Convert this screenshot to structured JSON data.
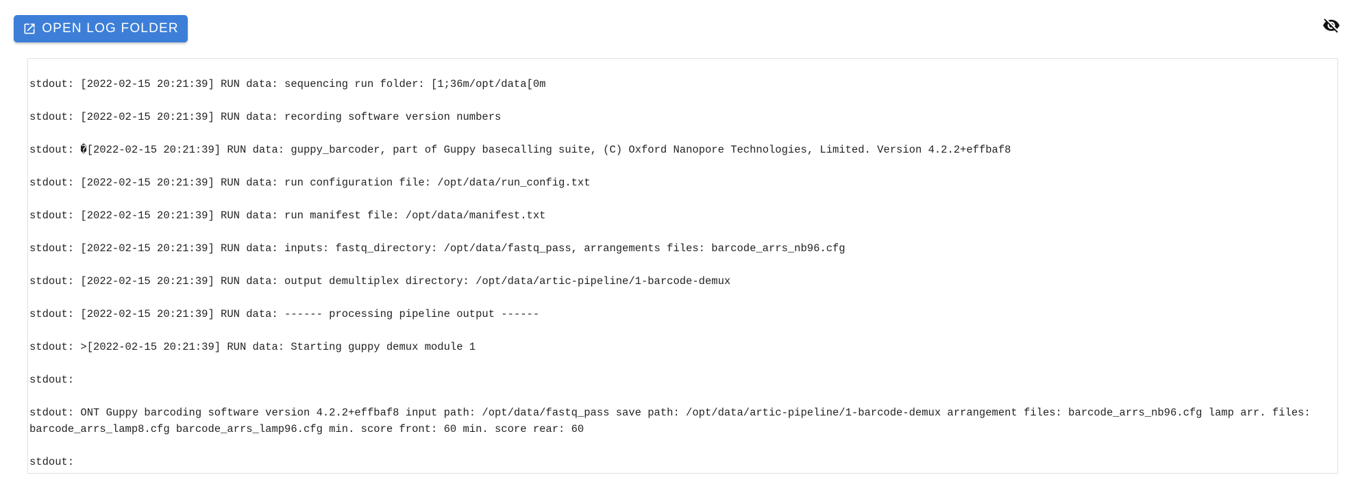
{
  "toolbar": {
    "open_log_folder_label": "OPEN LOG FOLDER",
    "open_log_folder_icon": "open-in-new-icon",
    "hide_toggle_icon": "eye-off-icon"
  },
  "colors": {
    "button_bg": "#3d7fd8",
    "button_text": "#ffffff",
    "log_text": "#222222",
    "panel_border": "#e0e0e0"
  },
  "log": {
    "lines": [
      "stdout: [2022-02-15 20:21:39] RUN data: sequencing run folder: [1;36m/opt/data[0m",
      "stdout: [2022-02-15 20:21:39] RUN data: recording software version numbers",
      "stdout: �[2022-02-15 20:21:39] RUN data: guppy_barcoder, part of Guppy basecalling suite, (C) Oxford Nanopore Technologies, Limited. Version 4.2.2+effbaf8",
      "stdout: [2022-02-15 20:21:39] RUN data: run configuration file: /opt/data/run_config.txt",
      "stdout: [2022-02-15 20:21:39] RUN data: run manifest file: /opt/data/manifest.txt",
      "stdout: [2022-02-15 20:21:39] RUN data: inputs: fastq_directory: /opt/data/fastq_pass, arrangements files: barcode_arrs_nb96.cfg",
      "stdout: [2022-02-15 20:21:39] RUN data: output demultiplex directory: /opt/data/artic-pipeline/1-barcode-demux",
      "stdout: [2022-02-15 20:21:39] RUN data: ------ processing pipeline output ------",
      "stdout: >[2022-02-15 20:21:39] RUN data: Starting guppy demux module 1",
      "stdout:",
      "stdout: ONT Guppy barcoding software version 4.2.2+effbaf8 input path: /opt/data/fastq_pass save path: /opt/data/artic-pipeline/1-barcode-demux arrangement files: barcode_arrs_nb96.cfg lamp arr. files: barcode_arrs_lamp8.cfg barcode_arrs_lamp96.cfg min. score front: 60 min. score rear: 60",
      "stdout:"
    ]
  }
}
